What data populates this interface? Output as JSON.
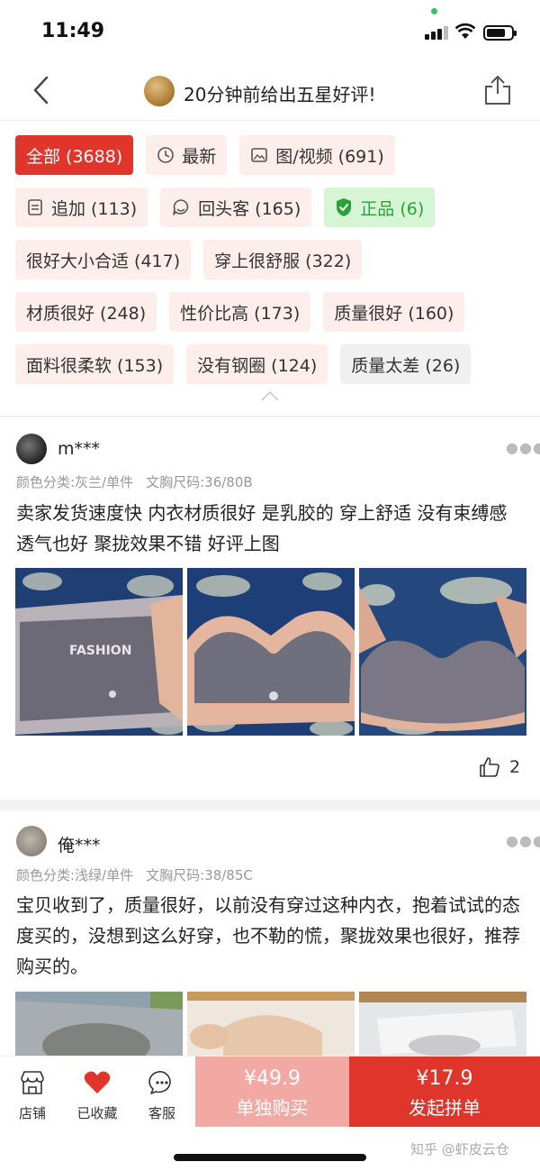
{
  "status_bar": {
    "time": "11:49"
  },
  "header": {
    "title": "20分钟前给出五星好评!"
  },
  "filters": {
    "rows": [
      [
        {
          "label": "全部 (3688)",
          "style": "active",
          "icon": ""
        },
        {
          "label": "最新",
          "style": "normal",
          "icon": "clock-icon"
        },
        {
          "label": "图/视频 (691)",
          "style": "normal",
          "icon": "image-icon"
        }
      ],
      [
        {
          "label": "追加 (113)",
          "style": "normal",
          "icon": "note-icon"
        },
        {
          "label": "回头客 (165)",
          "style": "normal",
          "icon": "returning-customer-icon"
        },
        {
          "label": "正品 (6)",
          "style": "green",
          "icon": "shield-check-icon"
        }
      ],
      [
        {
          "label": "很好大小合适 (417)",
          "style": "normal",
          "icon": ""
        },
        {
          "label": "穿上很舒服 (322)",
          "style": "normal",
          "icon": ""
        }
      ],
      [
        {
          "label": "材质很好 (248)",
          "style": "normal",
          "icon": ""
        },
        {
          "label": "性价比高 (173)",
          "style": "normal",
          "icon": ""
        },
        {
          "label": "质量很好 (160)",
          "style": "normal",
          "icon": ""
        }
      ],
      [
        {
          "label": "面料很柔软 (153)",
          "style": "normal",
          "icon": ""
        },
        {
          "label": "没有钢圈 (124)",
          "style": "normal",
          "icon": ""
        },
        {
          "label": "质量太差 (26)",
          "style": "gray",
          "icon": ""
        }
      ]
    ]
  },
  "reviews": [
    {
      "user": "m***",
      "color_spec": "颜色分类:灰兰/单件",
      "size_spec": "文胸尺码:36/80B",
      "text": "卖家发货速度快 内衣材质很好 是乳胶的 穿上舒适 没有束缚感 透气也好 聚拢效果不错 好评上图",
      "likes": "2",
      "photo_caption": "FASHION"
    },
    {
      "user": "俺***",
      "color_spec": "颜色分类:浅绿/单件",
      "size_spec": "文胸尺码:38/85C",
      "text": "宝贝收到了，质量很好，以前没有穿过这种内衣，抱着试试的态度买的，没想到这么好穿，也不勒的慌，聚拢效果也很好，推荐购买的。"
    }
  ],
  "bottom_bar": {
    "store_label": "店铺",
    "favorite_label": "已收藏",
    "service_label": "客服",
    "single_price": "¥49.9",
    "single_label": "单独购买",
    "group_price": "¥17.9",
    "group_label": "发起拼单"
  },
  "watermark": "知乎 @虾皮云仓",
  "colors": {
    "accent": "#e0352b",
    "accent_light": "#f2a9a3",
    "chip_bg": "#fdeeec",
    "green": "#2aa237"
  }
}
